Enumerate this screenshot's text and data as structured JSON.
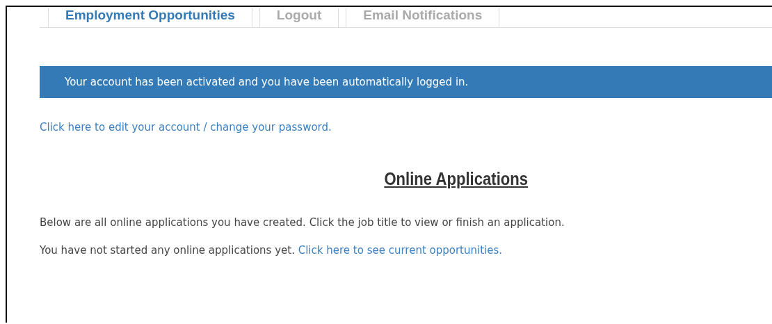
{
  "tabs": [
    {
      "label": "Employment Opportunities",
      "selected": true
    },
    {
      "label": "Logout",
      "selected": false
    },
    {
      "label": "Email Notifications",
      "selected": false
    }
  ],
  "alert": "Your account has been activated and you have been automatically logged in.",
  "account_link": "Click here to edit your account / change your password.",
  "heading": "Online Applications",
  "intro": "Below are all online applications you have created. Click the job title to view or finish an application.",
  "empty_message": {
    "text": "You have not started any online applications yet.",
    "link": "Click here to see current opportunities."
  }
}
